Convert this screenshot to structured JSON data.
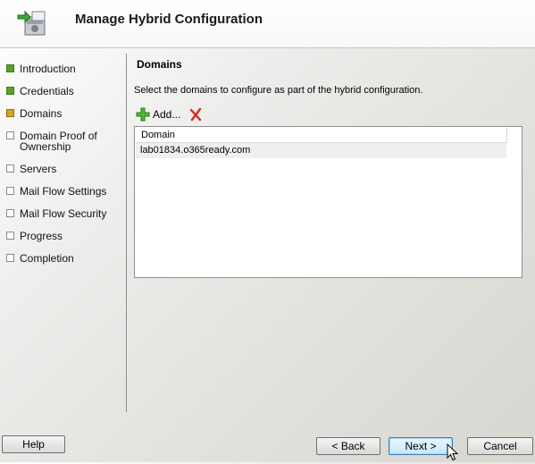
{
  "window": {
    "title": "Manage Hybrid Configuration",
    "icon": "hybrid-configuration-icon"
  },
  "steps": [
    {
      "label": "Introduction",
      "state": "completed"
    },
    {
      "label": "Credentials",
      "state": "completed"
    },
    {
      "label": "Domains",
      "state": "current"
    },
    {
      "label": "Domain Proof of",
      "label2": "Ownership",
      "state": "pending"
    },
    {
      "label": "Servers",
      "state": "pending"
    },
    {
      "label": "Mail Flow Settings",
      "state": "pending"
    },
    {
      "label": "Mail Flow Security",
      "state": "pending"
    },
    {
      "label": "Progress",
      "state": "pending"
    },
    {
      "label": "Completion",
      "state": "pending"
    }
  ],
  "main": {
    "section_title": "Domains",
    "instructions": "Select the domains to configure as part of the hybrid configuration.",
    "add_label": "Add...",
    "add_icon": "green-plus-icon",
    "remove_icon": "red-x-icon",
    "table": {
      "columns": [
        "Domain"
      ],
      "rows": [
        [
          "lab01834.o365ready.com"
        ]
      ]
    }
  },
  "footer": {
    "help_label": "Help",
    "back_label": "< Back",
    "next_label": "Next >",
    "cancel_label": "Cancel"
  },
  "colors": {
    "step_completed": "#5aa02c",
    "step_current": "#d4a51c",
    "step_pending": "#ffffff",
    "accent_button": "#3c7fb1"
  }
}
